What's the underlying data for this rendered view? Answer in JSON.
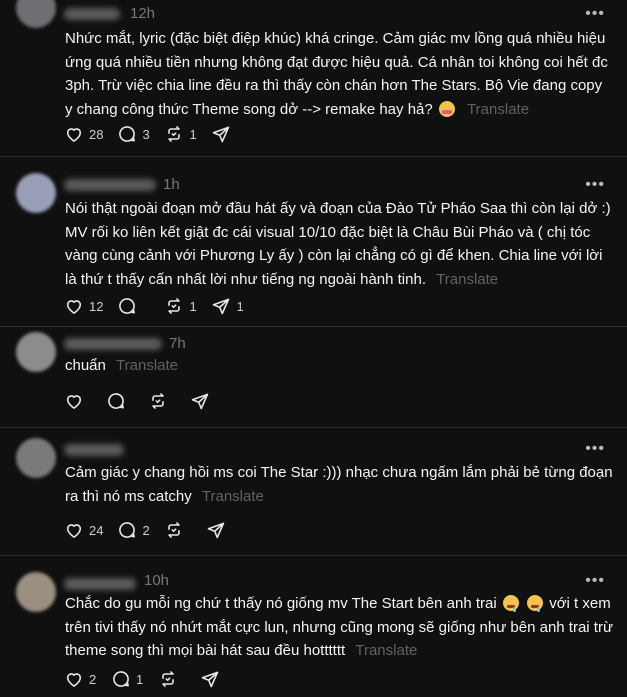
{
  "colors": {
    "background": "#101010",
    "text": "#f3f5f7",
    "muted": "#777777",
    "divider": "#2d2d2d"
  },
  "icons": {
    "like": "heart-icon",
    "reply": "comment-icon",
    "repost": "repost-icon",
    "share": "send-icon",
    "more": "more-icon"
  },
  "more_label": "•••",
  "posts": [
    {
      "time": "12h",
      "text": "Nhức mắt, lyric (đặc biệt điệp khúc) khá cringe. Cảm giác mv lồng quá nhiều hiệu ứng quá nhiều tiền nhưng không đạt được hiệu quả. Cá nhân toi không coi hết đc 3ph. Trừ việc chia line đều ra thì thấy còn chán hơn The Stars. Bộ Vie đang copy y chang công thức Theme song dở --> remake hay hả?",
      "translate": "Translate",
      "likes": "28",
      "replies": "3",
      "reposts": "1",
      "shares": ""
    },
    {
      "time": "1h",
      "text": "Nói thật ngoài đoạn mở đầu hát ấy và đoạn của Đào Tử Pháo Saa thì còn lại dở :) MV rối ko liên kết giật đc cái visual 10/10 đặc biệt là Châu Bùi Pháo và ( chị tóc vàng cùng cảnh với Phương Ly ấy ) còn lại chẳng có gì để khen. Chia line với lời là thứ t thấy cấn nhất lời như tiếng ng ngoài hành tinh.",
      "translate": "Translate",
      "likes": "12",
      "replies": "",
      "reposts": "1",
      "shares": "1"
    },
    {
      "time": "7h",
      "text": "chuẩn",
      "translate": "Translate",
      "likes": "",
      "replies": "",
      "reposts": "",
      "shares": ""
    },
    {
      "time": "",
      "text": "Cảm giác y chang hồi ms coi The Star :))) nhạc chưa ngấm lắm phải bẻ từng đoạn ra thì nó ms catchy",
      "translate": "Translate",
      "likes": "24",
      "replies": "2",
      "reposts": "",
      "shares": ""
    },
    {
      "time": "10h",
      "text_a": "Chắc do gu mỗi ng chứ t thấy nó giống mv The Start bên anh trai",
      "text_b": "với t xem trên tivi thấy nó nhứt mắt cực lun, nhưng cũng mong sẽ giống như bên anh trai trừ theme song thì mọi bài hát sau đều hotttttt",
      "translate": "Translate",
      "likes": "2",
      "replies": "1",
      "reposts": "",
      "shares": ""
    }
  ]
}
